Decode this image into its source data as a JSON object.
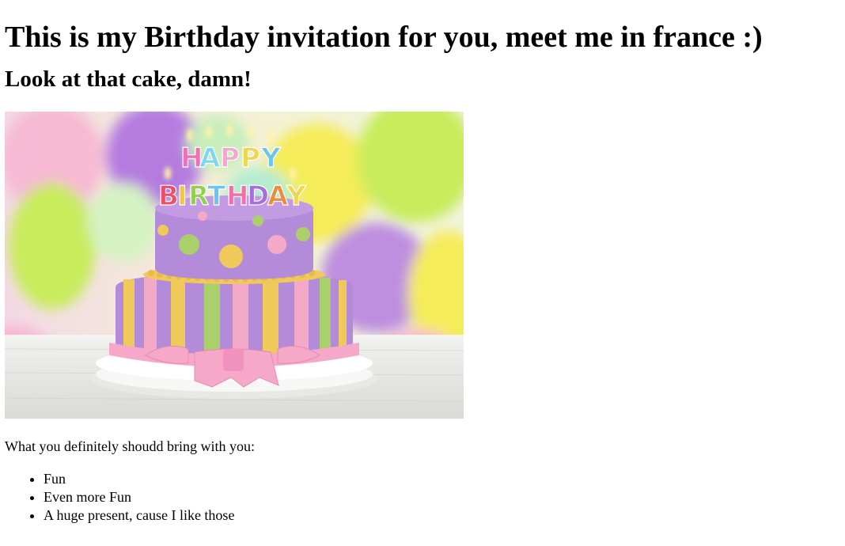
{
  "heading": "This is my Birthday invitation for you, meet me in france :)",
  "subheading": "Look at that cake, damn!",
  "image": {
    "candle_letters_top": [
      "H",
      "A",
      "P",
      "P",
      "Y"
    ],
    "candle_letters_bottom": [
      "B",
      "I",
      "R",
      "T",
      "H",
      "D",
      "A",
      "Y"
    ],
    "colors": {
      "background": "#f2ecd8",
      "balloon_purple": "#b57ce0",
      "balloon_yellow": "#f5ec5a",
      "balloon_green": "#c8ec5c",
      "balloon_pink": "#f7b6d2",
      "cake_purple": "#b38bd8",
      "cake_yellow": "#f0c95a",
      "cake_green": "#a9d06a",
      "cake_pink": "#f5a9c9",
      "ribbon_pink": "#f6a8c8",
      "table": "#e9e9e6"
    }
  },
  "bring_intro": "What you definitely shoudd bring with you:",
  "bring_list": [
    "Fun",
    "Even more Fun",
    "A huge present, cause I like those"
  ]
}
